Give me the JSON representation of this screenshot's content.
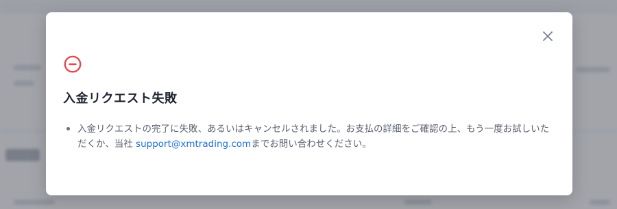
{
  "modal": {
    "close_icon": "close-icon",
    "status_icon": "error-circle-minus-icon",
    "title": "入金リクエスト失敗",
    "message": {
      "part1": "入金リクエストの完了に失敗、あるいはキャンセルされました。お支払の詳細をご確認の上、もう一度お試しいただくか、当社 ",
      "email": "support@xmtrading.com",
      "part2": "までお問い合わせください。"
    }
  },
  "colors": {
    "error_red": "#e5484d",
    "link_blue": "#1e6fd9",
    "title_text": "#1f2430",
    "body_text": "#5c6170"
  }
}
